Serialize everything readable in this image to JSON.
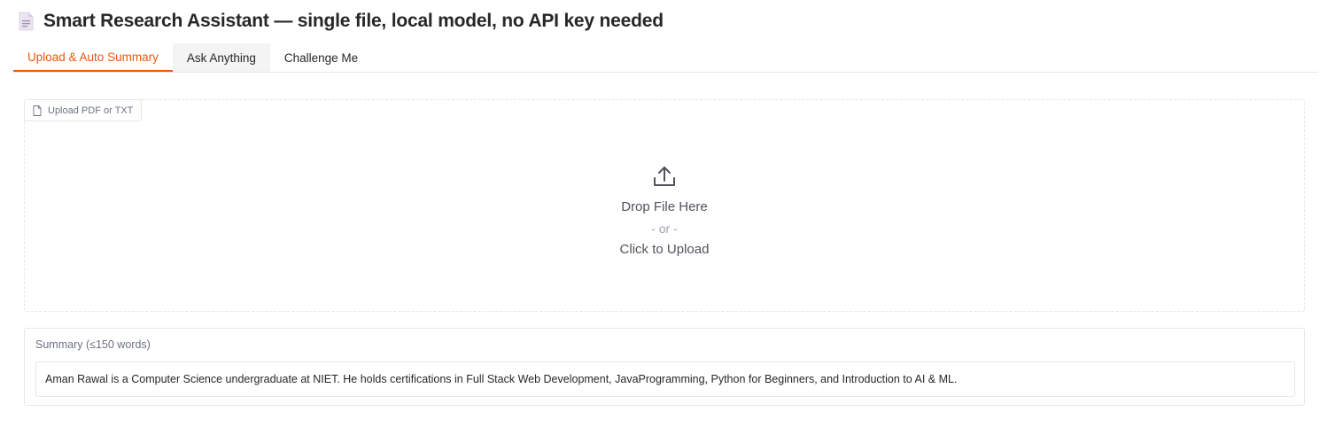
{
  "app": {
    "title": "Smart Research Assistant — single file, local model, no API key needed",
    "title_icon": "document-icon"
  },
  "tabs": [
    {
      "label": "Upload & Auto Summary",
      "active": true
    },
    {
      "label": "Ask Anything",
      "active": false
    },
    {
      "label": "Challenge Me",
      "active": false
    }
  ],
  "upload": {
    "label": "Upload PDF or TXT",
    "label_icon": "file-icon",
    "icon": "upload-arrow-icon",
    "drop_text": "Drop File Here",
    "or_text": "- or -",
    "click_text": "Click to Upload"
  },
  "summary": {
    "label": "Summary (≤150 words)",
    "value": "Aman Rawal is a Computer Science undergraduate at NIET. He holds certifications in Full Stack Web Development, JavaProgramming, Python for Beginners, and Introduction to AI & ML."
  },
  "colors": {
    "accent": "#ea580c",
    "border": "#e5e7eb",
    "muted_text": "#6b7280",
    "icon_tint": "#c4b5d4"
  }
}
